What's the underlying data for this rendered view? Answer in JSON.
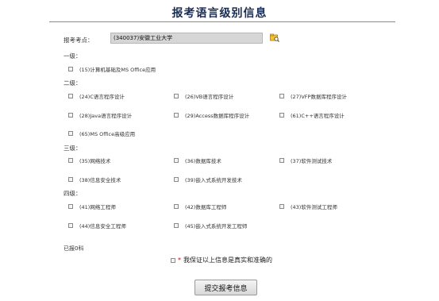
{
  "page": {
    "title": "报考语言级别信息"
  },
  "exam_site": {
    "label": "报考考点：",
    "value": "(340037)安徽工业大学"
  },
  "sections": {
    "level1": {
      "title": "一级：",
      "options": [
        "(15)计算机基础及MS Office应用"
      ]
    },
    "level2": {
      "title": "二级：",
      "options": [
        "(24)C语言程序设计",
        "(26)VB语言程序设计",
        "(27)VFP数据库程序设计",
        "(28)Java语言程序设计",
        "(29)Access数据库程序设计",
        "(61)C++语言程序设计",
        "(65)MS Office高级应用"
      ]
    },
    "level3": {
      "title": "三级：",
      "options": [
        "(35)网络技术",
        "(36)数据库技术",
        "(37)软件测试技术",
        "(38)信息安全技术",
        "(39)嵌入式系统开发技术"
      ]
    },
    "level4": {
      "title": "四级：",
      "options": [
        "(41)网络工程师",
        "(42)数据库工程师",
        "(43)软件测试工程师",
        "(44)信息安全工程师",
        "(45)嵌入式系统开发工程师"
      ]
    }
  },
  "registered_count": {
    "label": "已报0科"
  },
  "confirm": {
    "required_mark": "*",
    "label": "我保证以上信息是真实和准确的"
  },
  "submit": {
    "label": "提交报考信息"
  },
  "colors": {
    "title": "#1a2d55",
    "required": "#d40000",
    "field_bg": "#d6d6d6"
  },
  "icons": {
    "exam_site_lookup": "folder-search-icon"
  }
}
